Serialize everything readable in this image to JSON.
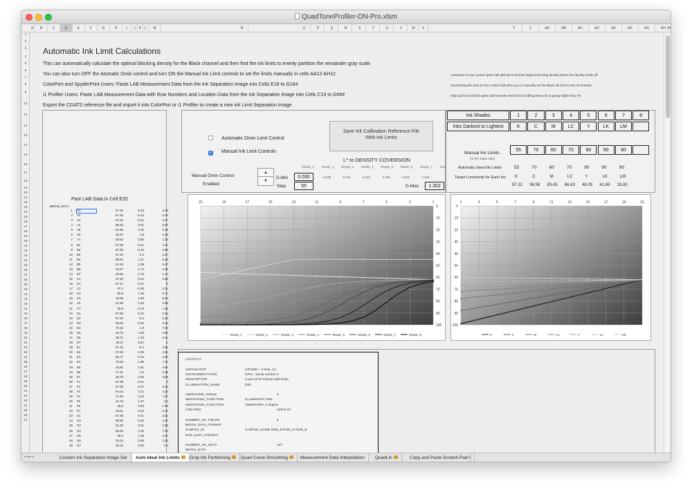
{
  "window": {
    "title": "QuadToneProfiler-DN-Pro.xlsm"
  },
  "columns": [
    "A",
    "B",
    "C",
    "D",
    "E",
    "F",
    "G",
    "H",
    "I",
    "J",
    "K",
    "L",
    "M",
    "N",
    "O",
    "P",
    "Q",
    "R",
    "S",
    "T",
    "U",
    "V",
    "W",
    "X",
    "Y",
    "Z",
    "AA",
    "AB",
    "AC",
    "AD",
    "AE",
    "AF",
    "AG",
    "AH",
    "AI"
  ],
  "rows": [
    "1",
    "2",
    "3",
    "4",
    "5",
    "6",
    "7",
    "8",
    "9",
    "10",
    "11",
    "12",
    "13",
    "14",
    "15",
    "16",
    "17",
    "18",
    "19",
    "20",
    "21",
    "22",
    "23",
    "24",
    "25",
    "26",
    "27",
    "28",
    "29",
    "30",
    "31",
    "32",
    "33",
    "34",
    "35",
    "36",
    "37",
    "38",
    "39",
    "40",
    "41",
    "42",
    "43",
    "44",
    "45",
    "46",
    "47",
    "48",
    "49",
    "50",
    "51",
    "52",
    "53",
    "54",
    "55",
    "56",
    "57",
    "58",
    "59",
    "60",
    "61",
    "62",
    "63",
    "64",
    "65",
    "66",
    "67"
  ],
  "heading": "Automatic Ink Limit Calculations",
  "intro": [
    "This can automatically calculate the optimal blocking density for the Black channel and then find the ink limits to evenly partition the remainder gray scale",
    "You can also turn OFF the Atumatic Dmin control and turn ON the Manual Ink Limit controls to set the limits manually in cells AA12-AH12",
    "ColorPort and SpyderPrint Users: Paste LAB Measurement Data from the Ink Separation Image into Cells E18 to G184",
    "i1 Profiler Users: Paste LAB Measurement Data with Row Numbers and Location Data from the Ink Separation Image into Cells C19 to G###",
    "Export the CGATS reference file and import it into ColorPort or i1 Profiler to create a new ink Limit Separation Image"
  ],
  "notes": [
    "Automatic D-max control option will attempt to find the highest blocking density before the density levels off.",
    "Unchecking the Auto D-max Control will allow you to manually set the Black ink level in 5% increments",
    "High and low ink limit option will keep the ink limit from falling below 20 or going higher than 70"
  ],
  "lab": {
    "title": "Past LAB Data in Cell E20",
    "begin": "BEGIN_DATA",
    "rows": [
      [
        "1",
        "A1",
        "97.45",
        "-0.43",
        "3.05"
      ],
      [
        "2",
        "A2",
        "97.36",
        "-0.43",
        "3.02"
      ],
      [
        "3",
        "A3",
        "97.26",
        "-0.41",
        "3.07"
      ],
      [
        "4",
        "A4",
        "88.25",
        "0.91",
        "5.87"
      ],
      [
        "5",
        "A5",
        "51.85",
        "2.03",
        "5.35"
      ],
      [
        "6",
        "A6",
        "45.97",
        "1.8",
        "4.49"
      ],
      [
        "7",
        "A7",
        "30.62",
        "0.86",
        "1.35"
      ],
      [
        "8",
        "B1",
        "97.39",
        "-0.41",
        "3.11"
      ],
      [
        "9",
        "B2",
        "97.45",
        "-0.43",
        "2.93"
      ],
      [
        "10",
        "B3",
        "97.19",
        "-0.4",
        "3.17"
      ],
      [
        "11",
        "B4",
        "85.54",
        "1.21",
        "6.43"
      ],
      [
        "12",
        "B5",
        "51.29",
        "2.08",
        "5.47"
      ],
      [
        "13",
        "B6",
        "43.47",
        "1.72",
        "4.08"
      ],
      [
        "14",
        "B7",
        "29.93",
        "0.76",
        "1.14"
      ],
      [
        "15",
        "C1",
        "97.39",
        "-0.42",
        "3.08"
      ],
      [
        "16",
        "C2",
        "97.41",
        "-0.41",
        "3"
      ],
      [
        "17",
        "C3",
        "97.2",
        "-0.38",
        "3.11"
      ],
      [
        "18",
        "C4",
        "82.8",
        "1.45",
        "6.74"
      ],
      [
        "19",
        "C5",
        "49.09",
        "1.95",
        "5.04"
      ],
      [
        "20",
        "C6",
        "41.69",
        "1.54",
        "3.58"
      ],
      [
        "21",
        "C7",
        "28.8",
        "0.76",
        "1.05"
      ],
      [
        "22",
        "D1",
        "97.36",
        "-0.42",
        "3.12"
      ],
      [
        "23",
        "D2",
        "97.43",
        "-0.4",
        "2.94"
      ],
      [
        "24",
        "D3",
        "96.93",
        "-0.32",
        "3.13"
      ],
      [
        "25",
        "D4",
        "79.16",
        "1.8",
        "7.03"
      ],
      [
        "26",
        "D5",
        "46.75",
        "1.83",
        "4.55"
      ],
      [
        "27",
        "D6",
        "39.71",
        "1.43",
        "3.11"
      ],
      [
        "28",
        "D7",
        "29.11",
        "0.67",
        "1"
      ],
      [
        "29",
        "E1",
        "97.43",
        "-0.4",
        "3.05"
      ],
      [
        "30",
        "E2",
        "97.38",
        "-0.39",
        "2.93"
      ],
      [
        "31",
        "E3",
        "95.77",
        "-0.16",
        "3.56"
      ],
      [
        "32",
        "E4",
        "75.45",
        "1.98",
        "7.11"
      ],
      [
        "33",
        "E5",
        "43.81",
        "1.61",
        "3.64"
      ],
      [
        "34",
        "E6",
        "37.31",
        "1.2",
        "2.39"
      ],
      [
        "35",
        "E7",
        "28.79",
        "0.58",
        "0.66"
      ],
      [
        "36",
        "F1",
        "97.38",
        "-0.41",
        "3"
      ],
      [
        "37",
        "F2",
        "97.08",
        "-0.37",
        "3.09"
      ],
      [
        "38",
        "F3",
        "94.16",
        "0.12",
        "4.25"
      ],
      [
        "39",
        "F4",
        "71.83",
        "2.23",
        "7.47"
      ],
      [
        "40",
        "F5",
        "41.76",
        "1.47",
        "3.2"
      ],
      [
        "41",
        "F6",
        "35.6",
        "0.93",
        "1.93"
      ],
      [
        "42",
        "F7",
        "28.61",
        "0.43",
        "0.24"
      ],
      [
        "43",
        "G1",
        "97.39",
        "-0.41",
        "3.01"
      ],
      [
        "44",
        "G2",
        "96.58",
        "-0.32",
        "3.24"
      ],
      [
        "45",
        "G3",
        "91.28",
        "0.51",
        "4.98"
      ],
      [
        "46",
        "G4",
        "66.63",
        "2.33",
        "7.22"
      ],
      [
        "47",
        "G5",
        "39.3",
        "1.28",
        "2.61"
      ],
      [
        "48",
        "G6",
        "34.15",
        "0.83",
        "1.52"
      ],
      [
        "49",
        "G7",
        "28.13",
        "0.32",
        "0.3"
      ]
    ]
  },
  "controls": {
    "auto_dmin_label": "Automatic Dmin Limit Control",
    "manual_ink_label": "Manual Ink Limit Controls",
    "save_button": "Save Ink Calibration Reference File\nWith Ink Limits",
    "manual_dmin_label": "Manual Dmin Control",
    "enabled_label": "Enabled",
    "spin_up": "▲",
    "spin_down": "▼"
  },
  "density": {
    "title": "L* to DENSITY COVERSION",
    "shade_labels": [
      "Shade_1",
      "Shade_2",
      "Shade_3",
      "Shade_4",
      "Shade_5",
      "Shade_6",
      "Shade_7",
      "Shade_8"
    ],
    "values": [
      "0.039",
      "0.201",
      "0.442",
      "0.753",
      "0.910",
      "1.240"
    ],
    "dmin_label": "D-Min",
    "dmin_value": "0.030",
    "step_label": "Step",
    "step_value": "55",
    "dmax_label": "D-Max",
    "dmax_value": "1.302"
  },
  "inks": {
    "shades_label": "Ink Shades",
    "shades": [
      "1",
      "2",
      "3",
      "4",
      "5",
      "6",
      "7",
      "8"
    ],
    "darkest_label": "Inks Darkest to Lightest",
    "names": [
      "K",
      "C",
      "M",
      "LC",
      "Y",
      "LK",
      "LM",
      ""
    ],
    "manual_label": "Manual Ink Limits",
    "manual_sub": "(In 5% steps only)",
    "manual_values": [
      "55",
      "70",
      "60",
      "70",
      "90",
      "90",
      "90",
      ""
    ],
    "auto_label": "Automatic Ideal Ink Limits",
    "auto_values": [
      "55",
      "70",
      "60",
      "70",
      "90",
      "90",
      "90"
    ],
    "target_label": "Target Luminosity for Each Ink",
    "target_names": [
      "K",
      "C",
      "M",
      "LC",
      "Y",
      "LK",
      "LM"
    ],
    "target_values": [
      "97.32",
      "96.58",
      "83.43",
      "66.63",
      "49.09",
      "41.69",
      "28.80"
    ]
  },
  "chart_left": {
    "x_ticks": [
      "21",
      "19",
      "17",
      "15",
      "13",
      "11",
      "9",
      "7",
      "5",
      "3",
      "1"
    ],
    "y_ticks": [
      "0",
      "10",
      "20",
      "30",
      "40",
      "50",
      "60",
      "70",
      "80",
      "90",
      "100"
    ],
    "legend": [
      "Shade_1",
      "Shade_2",
      "Shade_3",
      "Shade_4",
      "Shade_5",
      "Shade_6",
      "Shade_7",
      "Shade_8"
    ]
  },
  "chart_right": {
    "x_ticks": [
      "1",
      "3",
      "5",
      "7",
      "9",
      "11",
      "13",
      "15",
      "17",
      "19",
      "21"
    ],
    "y_ticks": [
      "0",
      "10",
      "20",
      "30",
      "40",
      "50",
      "60",
      "70",
      "80",
      "90",
      "100"
    ],
    "legend": [
      "K",
      "C",
      "M",
      "LC",
      "Y",
      "LK",
      "LM"
    ]
  },
  "cgats": {
    "rows": [
      [
        "CGATS.17",
        ""
      ],
      [
        "",
        ""
      ],
      [
        "ORIGINATOR",
        "i1Profiler - X-Rite, Inc."
      ],
      [
        "INSTRUMENTATION",
        "i1Pro ; Serial number 0"
      ],
      [
        "DESCRIPTOR",
        "i1-pro-QTR-InkSep-with limits"
      ],
      [
        "ILLUMINATION_NAME",
        "D50"
      ],
      [
        "",
        ""
      ],
      [
        "OBSERVER_ANGLE",
        "2"
      ],
      [
        "WEIGHTING_FUNCTION",
        "ILLUMINANT, D50"
      ],
      [
        "WEIGHTING_FUNCTION",
        "OBSERVER, 2 degree"
      ],
      [
        "CREATED",
        "42976.22"
      ],
      [
        "",
        ""
      ],
      [
        "NUMBER_OF_FIELDS",
        "5"
      ],
      [
        "BEGIN_DATA_FORMAT",
        ""
      ],
      [
        "SAMPLE_ID",
        "SAMPLE_NAME          RGB_R        RGB_G        RGB_B"
      ],
      [
        "END_DATA_FORMAT",
        ""
      ],
      [
        "",
        ""
      ],
      [
        "NUMBER_OF_SETS",
        "147"
      ],
      [
        "BEGIN_DATA",
        ""
      ]
    ]
  },
  "tabs": [
    "Custom Ink Separation Image Set",
    "Auto Ideal Ink Limits",
    "Gray Ink Partitioning",
    "Quad Curve Smoothing",
    "Measurement Data Interpolation",
    "QuadLin",
    "Copy and Paste Scratch Pad",
    "+"
  ]
}
